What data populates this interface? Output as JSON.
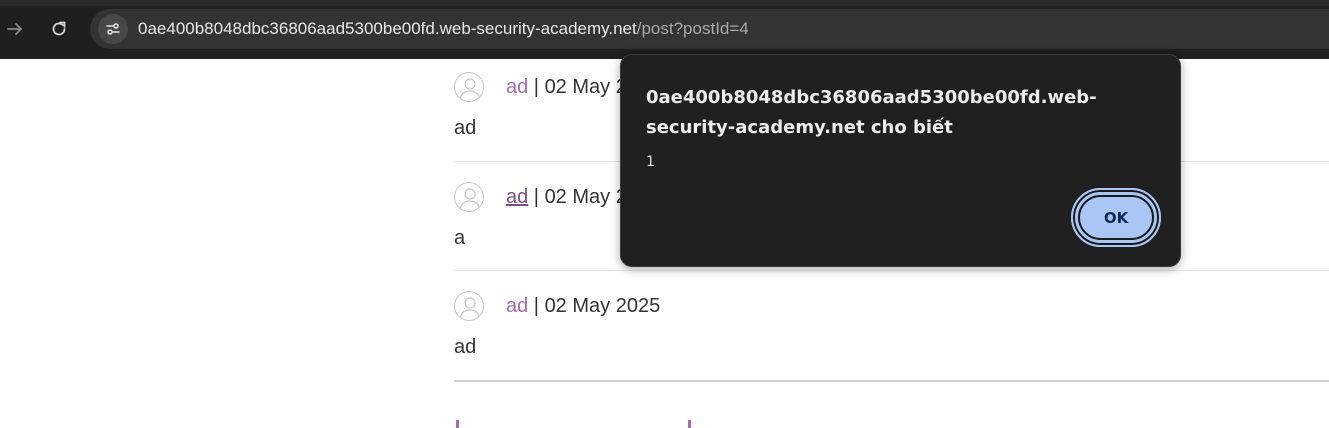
{
  "browser": {
    "url_host": "0ae400b8048dbc36806aad5300be00fd.web-security-academy.net",
    "url_path": "/post?postId=4"
  },
  "comments": [
    {
      "author": "ad",
      "separator": " | ",
      "date": "02 May 2",
      "text": "ad"
    },
    {
      "author": "ad",
      "separator": " | ",
      "date": "02 May 2",
      "text": "a"
    },
    {
      "author": "ad",
      "separator": " | ",
      "date": "02 May 2025",
      "text": "ad"
    }
  ],
  "alert": {
    "title": "0ae400b8048dbc36806aad5300be00fd.web-security-academy.net cho biết",
    "message": "1",
    "ok_label": "OK"
  }
}
